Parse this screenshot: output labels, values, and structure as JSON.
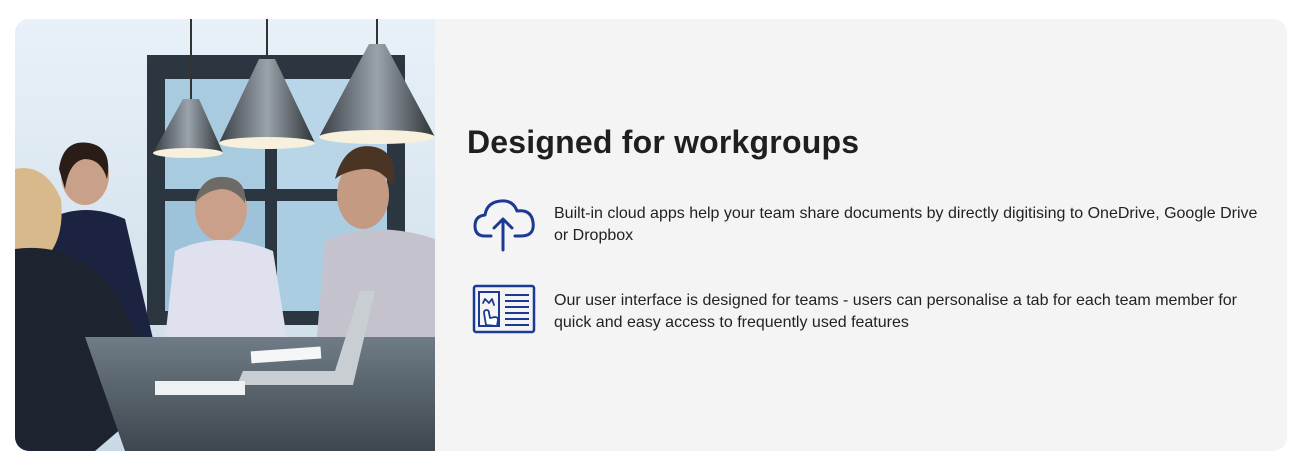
{
  "section": {
    "title": "Designed for workgroups",
    "accent_color": "#1a3a94",
    "features": [
      {
        "icon": "cloud-upload-icon",
        "text": "Built-in cloud apps help your team share documents by directly digitising to OneDrive, Google Drive or Dropbox"
      },
      {
        "icon": "touch-interface-icon",
        "text": "Our user interface is designed for teams - users can personalise a tab for each team member for quick and easy access to frequently used features"
      }
    ]
  },
  "image": {
    "subject": "team-meeting-photo"
  }
}
